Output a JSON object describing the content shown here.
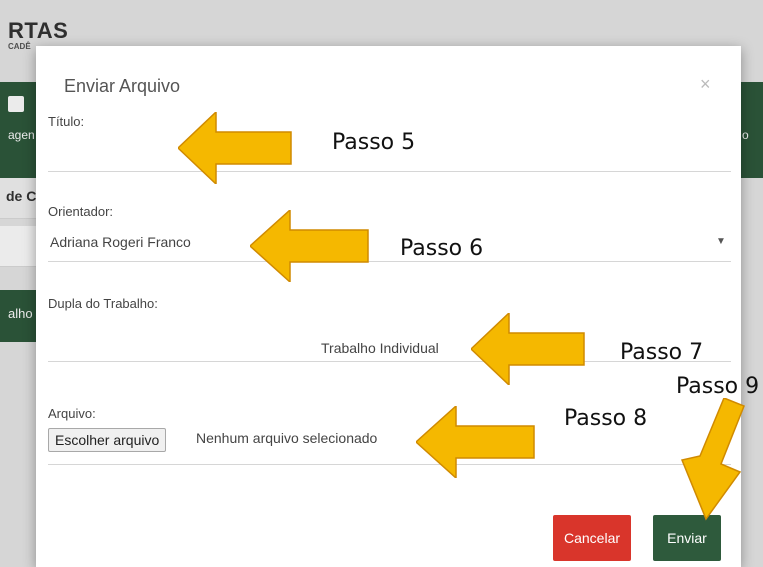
{
  "background": {
    "logo_text": "RTAS",
    "logo_sub": "CADÊ",
    "nav_left_text": "agen",
    "nav_right_text": "o",
    "strip_text": "de C",
    "button_text": "alho"
  },
  "modal": {
    "title": "Enviar Arquivo",
    "close_symbol": "×",
    "titulo": {
      "label": "Título:",
      "value": ""
    },
    "orientador": {
      "label": "Orientador:",
      "selected": "Adriana Rogeri Franco"
    },
    "dupla": {
      "label": "Dupla do Trabalho:",
      "value": "Trabalho Individual"
    },
    "arquivo": {
      "label": "Arquivo:",
      "button": "Escolher arquivo",
      "status": "Nenhum arquivo selecionado"
    },
    "buttons": {
      "cancel": "Cancelar",
      "send": "Enviar"
    }
  },
  "annotations": {
    "arrow_color": "#f5b800",
    "steps": [
      "Passo 5",
      "Passo 6",
      "Passo 7",
      "Passo 8",
      "Passo 9"
    ]
  },
  "colors": {
    "brand_green": "#2e5a3c",
    "danger_red": "#d9352b"
  }
}
